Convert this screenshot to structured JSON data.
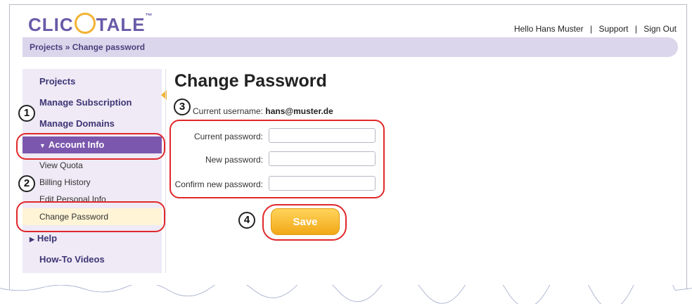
{
  "header": {
    "logo_text": "CLICTALE",
    "logo_tm": "™",
    "greeting": "Hello Hans Muster",
    "support_link": "Support",
    "signout_link": "Sign Out",
    "separator": "|"
  },
  "breadcrumb": "Projects » Change password",
  "sidebar": {
    "items": [
      {
        "label": "Projects"
      },
      {
        "label": "Manage Subscription"
      },
      {
        "label": "Manage Domains"
      },
      {
        "label": "Account Info"
      },
      {
        "label": "Help"
      },
      {
        "label": "How-To Videos"
      }
    ],
    "subitems": [
      {
        "label": "View Quota"
      },
      {
        "label": "Billing History"
      },
      {
        "label": "Edit Personal Info"
      },
      {
        "label": "Change Password"
      }
    ]
  },
  "main": {
    "title": "Change Password",
    "username_label": "Current username:",
    "username_value": "hans@muster.de",
    "fields": [
      {
        "label": "Current password:",
        "value": ""
      },
      {
        "label": "New password:",
        "value": ""
      },
      {
        "label": "Confirm new password:",
        "value": ""
      }
    ],
    "save_label": "Save"
  },
  "annotations": [
    "1",
    "2",
    "3",
    "4"
  ],
  "colors": {
    "brand_purple": "#7b57ad",
    "accent_orange": "#f2b233",
    "annotation_red": "#e0282a"
  }
}
